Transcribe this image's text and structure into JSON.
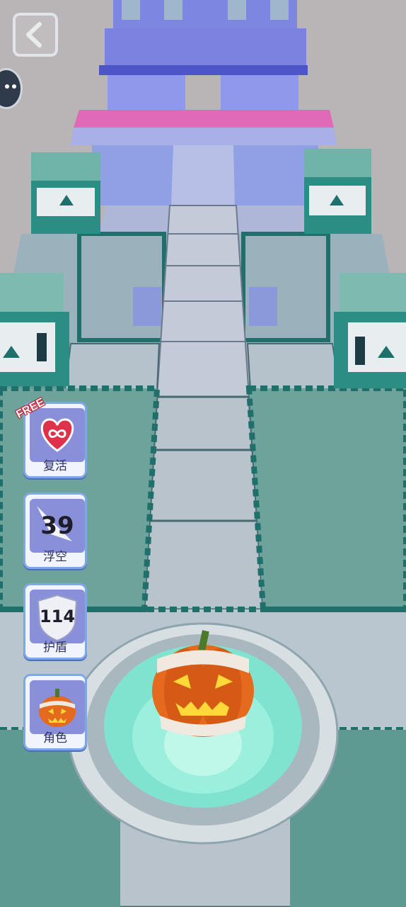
{
  "colors": {
    "track_tile": "#b7c8cf",
    "track_border": "#1f6f6a",
    "floor": "#5f9a92",
    "button_bg": "#8a8fd9",
    "free_badge": "#c0192b"
  },
  "icons": {
    "back": "chevron-left-icon",
    "revive": "infinity-heart-icon",
    "float": "float-count-icon",
    "shield": "shield-icon",
    "character": "pumpkin-icon"
  },
  "powerups": {
    "revive": {
      "label": "复活",
      "badge": "FREE"
    },
    "float": {
      "label": "浮空",
      "count": "39"
    },
    "shield": {
      "label": "护盾",
      "count": "114"
    },
    "character": {
      "label": "角色"
    }
  }
}
